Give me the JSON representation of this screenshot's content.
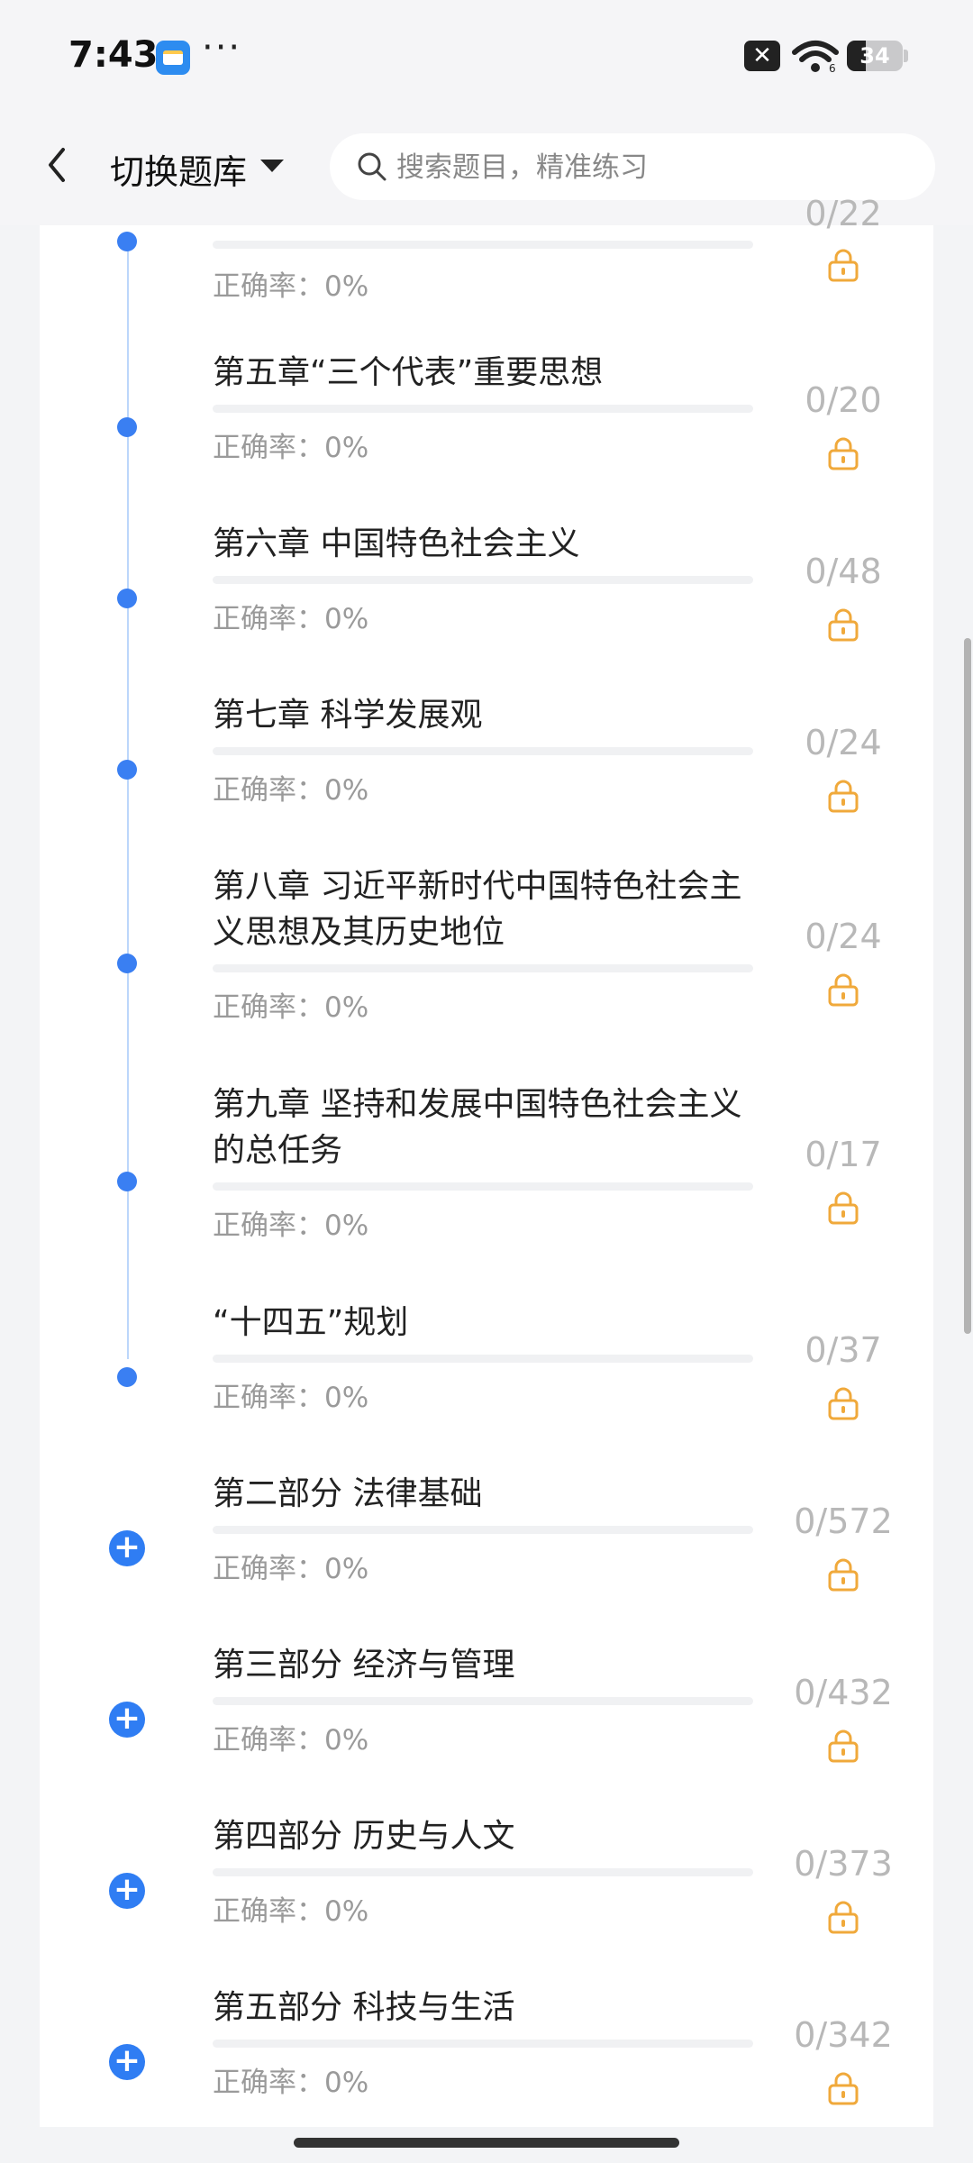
{
  "status_bar": {
    "time": "7:43",
    "dots": "···",
    "battery": "34",
    "battery_level": 0.34
  },
  "header": {
    "switch_label": "切换题库",
    "search_placeholder": "搜索题目，精准练习"
  },
  "rate_label": "正确率：",
  "chapters": [
    {
      "title": "",
      "rate": "0%",
      "count": "0/22",
      "kind": "dot"
    },
    {
      "title": "第五章“三个代表”重要思想",
      "rate": "0%",
      "count": "0/20",
      "kind": "dot"
    },
    {
      "title": "第六章 中国特色社会主义",
      "rate": "0%",
      "count": "0/48",
      "kind": "dot"
    },
    {
      "title": "第七章 科学发展观",
      "rate": "0%",
      "count": "0/24",
      "kind": "dot"
    },
    {
      "title": "第八章 习近平新时代中国特色社会主义思想及其历史地位",
      "rate": "0%",
      "count": "0/24",
      "kind": "dot"
    },
    {
      "title": "第九章 坚持和发展中国特色社会主义的总任务",
      "rate": "0%",
      "count": "0/17",
      "kind": "dot"
    },
    {
      "title": "“十四五”规划",
      "rate": "0%",
      "count": "0/37",
      "kind": "dot"
    },
    {
      "title": "第二部分 法律基础",
      "rate": "0%",
      "count": "0/572",
      "kind": "plus"
    },
    {
      "title": "第三部分 经济与管理",
      "rate": "0%",
      "count": "0/432",
      "kind": "plus"
    },
    {
      "title": "第四部分 历史与人文",
      "rate": "0%",
      "count": "0/373",
      "kind": "plus"
    },
    {
      "title": "第五部分 科技与生活",
      "rate": "0%",
      "count": "0/342",
      "kind": "plus"
    }
  ],
  "colors": {
    "accent": "#2f7df3",
    "lock": "#f0a93b",
    "count": "#b8b8b8",
    "rate": "#9a9a9a"
  }
}
